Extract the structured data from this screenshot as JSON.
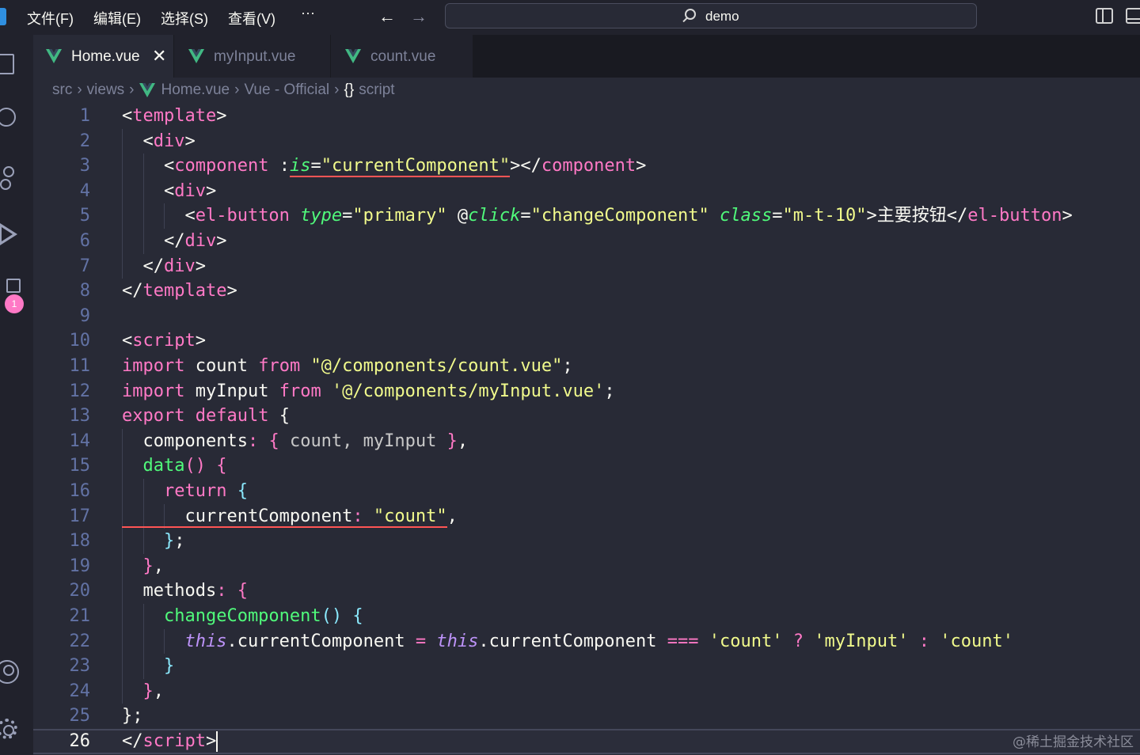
{
  "titlebar": {
    "menus": [
      "文件(F)",
      "编辑(E)",
      "选择(S)",
      "查看(V)",
      "···"
    ],
    "search_text": "demo"
  },
  "activity_bar": {
    "extensions_badge": "1"
  },
  "tabs": [
    {
      "label": "Home.vue",
      "active": true,
      "closable": true
    },
    {
      "label": "myInput.vue",
      "active": false
    },
    {
      "label": "count.vue",
      "active": false
    }
  ],
  "breadcrumb": [
    "src",
    "views",
    "Home.vue",
    "Vue - Official",
    "script"
  ],
  "breadcrumb_braces": "{}",
  "editor": {
    "current_line": 26,
    "lines": [
      {
        "n": "1",
        "tokens": [
          [
            "t-punc",
            "<"
          ],
          [
            "t-tag",
            "template"
          ],
          [
            "t-punc",
            ">"
          ]
        ]
      },
      {
        "n": "2",
        "tokens": [
          [
            "t-punc",
            "  <"
          ],
          [
            "t-tag",
            "div"
          ],
          [
            "t-punc",
            ">"
          ]
        ]
      },
      {
        "n": "3",
        "tokens": [
          [
            "t-punc",
            "    <"
          ],
          [
            "t-tag",
            "component"
          ],
          [
            "t-punc",
            " :"
          ],
          [
            "t-attr",
            "is"
          ],
          [
            "t-punc",
            "="
          ],
          [
            "t-str",
            "\"currentComponent\""
          ],
          [
            "t-punc",
            "></"
          ],
          [
            "t-tag",
            "component"
          ],
          [
            "t-punc",
            ">"
          ]
        ]
      },
      {
        "n": "4",
        "tokens": [
          [
            "t-punc",
            "    <"
          ],
          [
            "t-tag",
            "div"
          ],
          [
            "t-punc",
            ">"
          ]
        ]
      },
      {
        "n": "5",
        "tokens": [
          [
            "t-punc",
            "      <"
          ],
          [
            "t-tag",
            "el-button"
          ],
          [
            "t-punc",
            " "
          ],
          [
            "t-attr",
            "type"
          ],
          [
            "t-punc",
            "="
          ],
          [
            "t-str",
            "\"primary\""
          ],
          [
            "t-punc",
            " @"
          ],
          [
            "t-attr",
            "click"
          ],
          [
            "t-punc",
            "="
          ],
          [
            "t-str",
            "\"changeComponent\""
          ],
          [
            "t-punc",
            " "
          ],
          [
            "t-attr",
            "class"
          ],
          [
            "t-punc",
            "="
          ],
          [
            "t-str",
            "\"m-t-10\""
          ],
          [
            "t-punc",
            ">主要按钮</"
          ],
          [
            "t-tag",
            "el-button"
          ],
          [
            "t-punc",
            ">"
          ]
        ]
      },
      {
        "n": "6",
        "tokens": [
          [
            "t-punc",
            "    </"
          ],
          [
            "t-tag",
            "div"
          ],
          [
            "t-punc",
            ">"
          ]
        ]
      },
      {
        "n": "7",
        "tokens": [
          [
            "t-punc",
            "  </"
          ],
          [
            "t-tag",
            "div"
          ],
          [
            "t-punc",
            ">"
          ]
        ]
      },
      {
        "n": "8",
        "tokens": [
          [
            "t-punc",
            "</"
          ],
          [
            "t-tag",
            "template"
          ],
          [
            "t-punc",
            ">"
          ]
        ]
      },
      {
        "n": "9",
        "tokens": []
      },
      {
        "n": "10",
        "tokens": [
          [
            "t-punc",
            "<"
          ],
          [
            "t-tag",
            "script"
          ],
          [
            "t-punc",
            ">"
          ]
        ]
      },
      {
        "n": "11",
        "tokens": [
          [
            "t-kw",
            "import"
          ],
          [
            "t-var",
            " count "
          ],
          [
            "t-kw",
            "from"
          ],
          [
            "t-var",
            " "
          ],
          [
            "t-str",
            "\"@/components/count.vue\""
          ],
          [
            "t-punc",
            ";"
          ]
        ]
      },
      {
        "n": "12",
        "tokens": [
          [
            "t-kw",
            "import"
          ],
          [
            "t-var",
            " myInput "
          ],
          [
            "t-kw",
            "from"
          ],
          [
            "t-var",
            " "
          ],
          [
            "t-str",
            "'@/components/myInput.vue'"
          ],
          [
            "t-punc",
            ";"
          ]
        ]
      },
      {
        "n": "13",
        "tokens": [
          [
            "t-kw",
            "export"
          ],
          [
            "t-var",
            " "
          ],
          [
            "t-kw",
            "default"
          ],
          [
            "t-var",
            " "
          ],
          [
            "t-brace1",
            "{"
          ]
        ]
      },
      {
        "n": "14",
        "tokens": [
          [
            "t-var",
            "  components"
          ],
          [
            "t-op",
            ":"
          ],
          [
            "t-var",
            " "
          ],
          [
            "t-brace2",
            "{"
          ],
          [
            "t-dim",
            " count, myInput "
          ],
          [
            "t-brace2",
            "}"
          ],
          [
            "t-punc",
            ","
          ]
        ]
      },
      {
        "n": "15",
        "tokens": [
          [
            "t-fn",
            "  data"
          ],
          [
            "t-brace2",
            "()"
          ],
          [
            "t-var",
            " "
          ],
          [
            "t-brace2",
            "{"
          ]
        ]
      },
      {
        "n": "16",
        "tokens": [
          [
            "t-kw",
            "    return"
          ],
          [
            "t-var",
            " "
          ],
          [
            "t-brace3",
            "{"
          ]
        ]
      },
      {
        "n": "17",
        "tokens": [
          [
            "t-var",
            "      currentComponent"
          ],
          [
            "t-op",
            ":"
          ],
          [
            "t-var",
            " "
          ],
          [
            "t-str",
            "\"count\""
          ],
          [
            "t-punc",
            ","
          ]
        ]
      },
      {
        "n": "18",
        "tokens": [
          [
            "t-brace3",
            "    }"
          ],
          [
            "t-punc",
            ";"
          ]
        ]
      },
      {
        "n": "19",
        "tokens": [
          [
            "t-brace2",
            "  }"
          ],
          [
            "t-punc",
            ","
          ]
        ]
      },
      {
        "n": "20",
        "tokens": [
          [
            "t-var",
            "  methods"
          ],
          [
            "t-op",
            ":"
          ],
          [
            "t-var",
            " "
          ],
          [
            "t-brace2",
            "{"
          ]
        ]
      },
      {
        "n": "21",
        "tokens": [
          [
            "t-fn",
            "    changeComponent"
          ],
          [
            "t-brace3",
            "()"
          ],
          [
            "t-var",
            " "
          ],
          [
            "t-brace3",
            "{"
          ]
        ]
      },
      {
        "n": "22",
        "tokens": [
          [
            "t-this",
            "      this"
          ],
          [
            "t-var",
            ".currentComponent "
          ],
          [
            "t-op",
            "="
          ],
          [
            "t-var",
            " "
          ],
          [
            "t-this",
            "this"
          ],
          [
            "t-var",
            ".currentComponent "
          ],
          [
            "t-op",
            "==="
          ],
          [
            "t-var",
            " "
          ],
          [
            "t-str",
            "'count'"
          ],
          [
            "t-var",
            " "
          ],
          [
            "t-op",
            "?"
          ],
          [
            "t-var",
            " "
          ],
          [
            "t-str",
            "'myInput'"
          ],
          [
            "t-var",
            " "
          ],
          [
            "t-op",
            ":"
          ],
          [
            "t-var",
            " "
          ],
          [
            "t-str",
            "'count'"
          ]
        ]
      },
      {
        "n": "23",
        "tokens": [
          [
            "t-brace3",
            "    }"
          ]
        ]
      },
      {
        "n": "24",
        "tokens": [
          [
            "t-brace2",
            "  }"
          ],
          [
            "t-punc",
            ","
          ]
        ]
      },
      {
        "n": "25",
        "tokens": [
          [
            "t-brace1",
            "}"
          ],
          [
            "t-punc",
            ";"
          ]
        ]
      },
      {
        "n": "26",
        "tokens": [
          [
            "t-punc",
            "</"
          ],
          [
            "t-tag",
            "script"
          ],
          [
            "t-punc",
            ">"
          ]
        ]
      }
    ]
  },
  "watermark": "@稀土掘金技术社区",
  "colors": {
    "background": "#282a36",
    "vue_green": "#41b883",
    "accent_pink": "#ff79c6"
  }
}
